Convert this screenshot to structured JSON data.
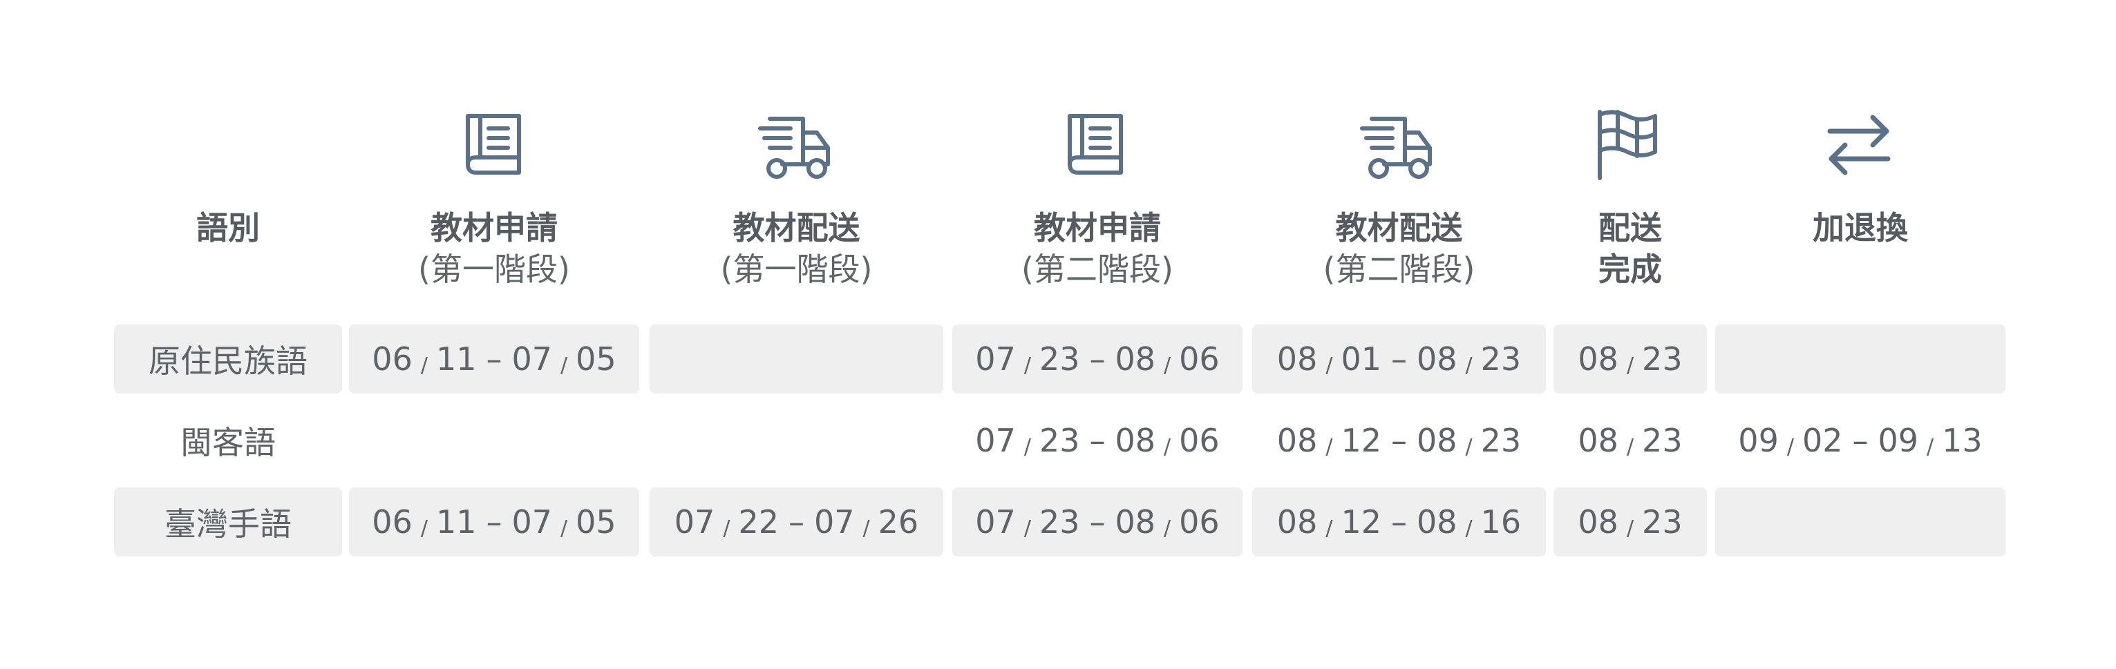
{
  "colors": {
    "icon_stroke": "#5a7189",
    "text": "#555b61",
    "row_shade": "#efefef"
  },
  "header": {
    "language_label": "語別",
    "columns": [
      {
        "icon": "book-icon",
        "title": "教材申請",
        "subtitle": "(第一階段)"
      },
      {
        "icon": "truck-icon",
        "title": "教材配送",
        "subtitle": "(第一階段)"
      },
      {
        "icon": "book-icon",
        "title": "教材申請",
        "subtitle": "(第二階段)"
      },
      {
        "icon": "truck-icon",
        "title": "教材配送",
        "subtitle": "(第二階段)"
      },
      {
        "icon": "flag-icon",
        "title": "配送",
        "subtitle": "完成"
      },
      {
        "icon": "exchange-arrows-icon",
        "title": "加退換",
        "subtitle": ""
      }
    ]
  },
  "rows": [
    {
      "language": "原住民族語",
      "cells": [
        {
          "start": [
            "06",
            "11"
          ],
          "end": [
            "07",
            "05"
          ]
        },
        null,
        {
          "start": [
            "07",
            "23"
          ],
          "end": [
            "08",
            "06"
          ]
        },
        {
          "start": [
            "08",
            "01"
          ],
          "end": [
            "08",
            "23"
          ]
        },
        {
          "start": [
            "08",
            "23"
          ],
          "end": null
        },
        null
      ]
    },
    {
      "language": "閩客語",
      "cells": [
        null,
        null,
        {
          "start": [
            "07",
            "23"
          ],
          "end": [
            "08",
            "06"
          ]
        },
        {
          "start": [
            "08",
            "12"
          ],
          "end": [
            "08",
            "23"
          ]
        },
        {
          "start": [
            "08",
            "23"
          ],
          "end": null
        },
        {
          "start": [
            "09",
            "02"
          ],
          "end": [
            "09",
            "13"
          ]
        }
      ]
    },
    {
      "language": "臺灣手語",
      "cells": [
        {
          "start": [
            "06",
            "11"
          ],
          "end": [
            "07",
            "05"
          ]
        },
        {
          "start": [
            "07",
            "22"
          ],
          "end": [
            "07",
            "26"
          ]
        },
        {
          "start": [
            "07",
            "23"
          ],
          "end": [
            "08",
            "06"
          ]
        },
        {
          "start": [
            "08",
            "12"
          ],
          "end": [
            "08",
            "16"
          ]
        },
        {
          "start": [
            "08",
            "23"
          ],
          "end": null
        },
        null
      ]
    }
  ],
  "separator": "/",
  "range_dash": "–"
}
